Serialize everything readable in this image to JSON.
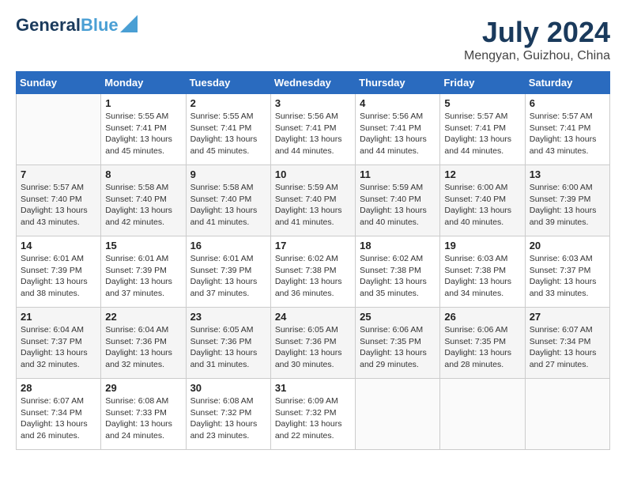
{
  "header": {
    "logo_line1": "General",
    "logo_line2": "Blue",
    "month": "July 2024",
    "location": "Mengyan, Guizhou, China"
  },
  "weekdays": [
    "Sunday",
    "Monday",
    "Tuesday",
    "Wednesday",
    "Thursday",
    "Friday",
    "Saturday"
  ],
  "weeks": [
    [
      {
        "day": "",
        "info": ""
      },
      {
        "day": "1",
        "info": "Sunrise: 5:55 AM\nSunset: 7:41 PM\nDaylight: 13 hours\nand 45 minutes."
      },
      {
        "day": "2",
        "info": "Sunrise: 5:55 AM\nSunset: 7:41 PM\nDaylight: 13 hours\nand 45 minutes."
      },
      {
        "day": "3",
        "info": "Sunrise: 5:56 AM\nSunset: 7:41 PM\nDaylight: 13 hours\nand 44 minutes."
      },
      {
        "day": "4",
        "info": "Sunrise: 5:56 AM\nSunset: 7:41 PM\nDaylight: 13 hours\nand 44 minutes."
      },
      {
        "day": "5",
        "info": "Sunrise: 5:57 AM\nSunset: 7:41 PM\nDaylight: 13 hours\nand 44 minutes."
      },
      {
        "day": "6",
        "info": "Sunrise: 5:57 AM\nSunset: 7:41 PM\nDaylight: 13 hours\nand 43 minutes."
      }
    ],
    [
      {
        "day": "7",
        "info": "Sunrise: 5:57 AM\nSunset: 7:40 PM\nDaylight: 13 hours\nand 43 minutes."
      },
      {
        "day": "8",
        "info": "Sunrise: 5:58 AM\nSunset: 7:40 PM\nDaylight: 13 hours\nand 42 minutes."
      },
      {
        "day": "9",
        "info": "Sunrise: 5:58 AM\nSunset: 7:40 PM\nDaylight: 13 hours\nand 41 minutes."
      },
      {
        "day": "10",
        "info": "Sunrise: 5:59 AM\nSunset: 7:40 PM\nDaylight: 13 hours\nand 41 minutes."
      },
      {
        "day": "11",
        "info": "Sunrise: 5:59 AM\nSunset: 7:40 PM\nDaylight: 13 hours\nand 40 minutes."
      },
      {
        "day": "12",
        "info": "Sunrise: 6:00 AM\nSunset: 7:40 PM\nDaylight: 13 hours\nand 40 minutes."
      },
      {
        "day": "13",
        "info": "Sunrise: 6:00 AM\nSunset: 7:39 PM\nDaylight: 13 hours\nand 39 minutes."
      }
    ],
    [
      {
        "day": "14",
        "info": "Sunrise: 6:01 AM\nSunset: 7:39 PM\nDaylight: 13 hours\nand 38 minutes."
      },
      {
        "day": "15",
        "info": "Sunrise: 6:01 AM\nSunset: 7:39 PM\nDaylight: 13 hours\nand 37 minutes."
      },
      {
        "day": "16",
        "info": "Sunrise: 6:01 AM\nSunset: 7:39 PM\nDaylight: 13 hours\nand 37 minutes."
      },
      {
        "day": "17",
        "info": "Sunrise: 6:02 AM\nSunset: 7:38 PM\nDaylight: 13 hours\nand 36 minutes."
      },
      {
        "day": "18",
        "info": "Sunrise: 6:02 AM\nSunset: 7:38 PM\nDaylight: 13 hours\nand 35 minutes."
      },
      {
        "day": "19",
        "info": "Sunrise: 6:03 AM\nSunset: 7:38 PM\nDaylight: 13 hours\nand 34 minutes."
      },
      {
        "day": "20",
        "info": "Sunrise: 6:03 AM\nSunset: 7:37 PM\nDaylight: 13 hours\nand 33 minutes."
      }
    ],
    [
      {
        "day": "21",
        "info": "Sunrise: 6:04 AM\nSunset: 7:37 PM\nDaylight: 13 hours\nand 32 minutes."
      },
      {
        "day": "22",
        "info": "Sunrise: 6:04 AM\nSunset: 7:36 PM\nDaylight: 13 hours\nand 32 minutes."
      },
      {
        "day": "23",
        "info": "Sunrise: 6:05 AM\nSunset: 7:36 PM\nDaylight: 13 hours\nand 31 minutes."
      },
      {
        "day": "24",
        "info": "Sunrise: 6:05 AM\nSunset: 7:36 PM\nDaylight: 13 hours\nand 30 minutes."
      },
      {
        "day": "25",
        "info": "Sunrise: 6:06 AM\nSunset: 7:35 PM\nDaylight: 13 hours\nand 29 minutes."
      },
      {
        "day": "26",
        "info": "Sunrise: 6:06 AM\nSunset: 7:35 PM\nDaylight: 13 hours\nand 28 minutes."
      },
      {
        "day": "27",
        "info": "Sunrise: 6:07 AM\nSunset: 7:34 PM\nDaylight: 13 hours\nand 27 minutes."
      }
    ],
    [
      {
        "day": "28",
        "info": "Sunrise: 6:07 AM\nSunset: 7:34 PM\nDaylight: 13 hours\nand 26 minutes."
      },
      {
        "day": "29",
        "info": "Sunrise: 6:08 AM\nSunset: 7:33 PM\nDaylight: 13 hours\nand 24 minutes."
      },
      {
        "day": "30",
        "info": "Sunrise: 6:08 AM\nSunset: 7:32 PM\nDaylight: 13 hours\nand 23 minutes."
      },
      {
        "day": "31",
        "info": "Sunrise: 6:09 AM\nSunset: 7:32 PM\nDaylight: 13 hours\nand 22 minutes."
      },
      {
        "day": "",
        "info": ""
      },
      {
        "day": "",
        "info": ""
      },
      {
        "day": "",
        "info": ""
      }
    ]
  ]
}
